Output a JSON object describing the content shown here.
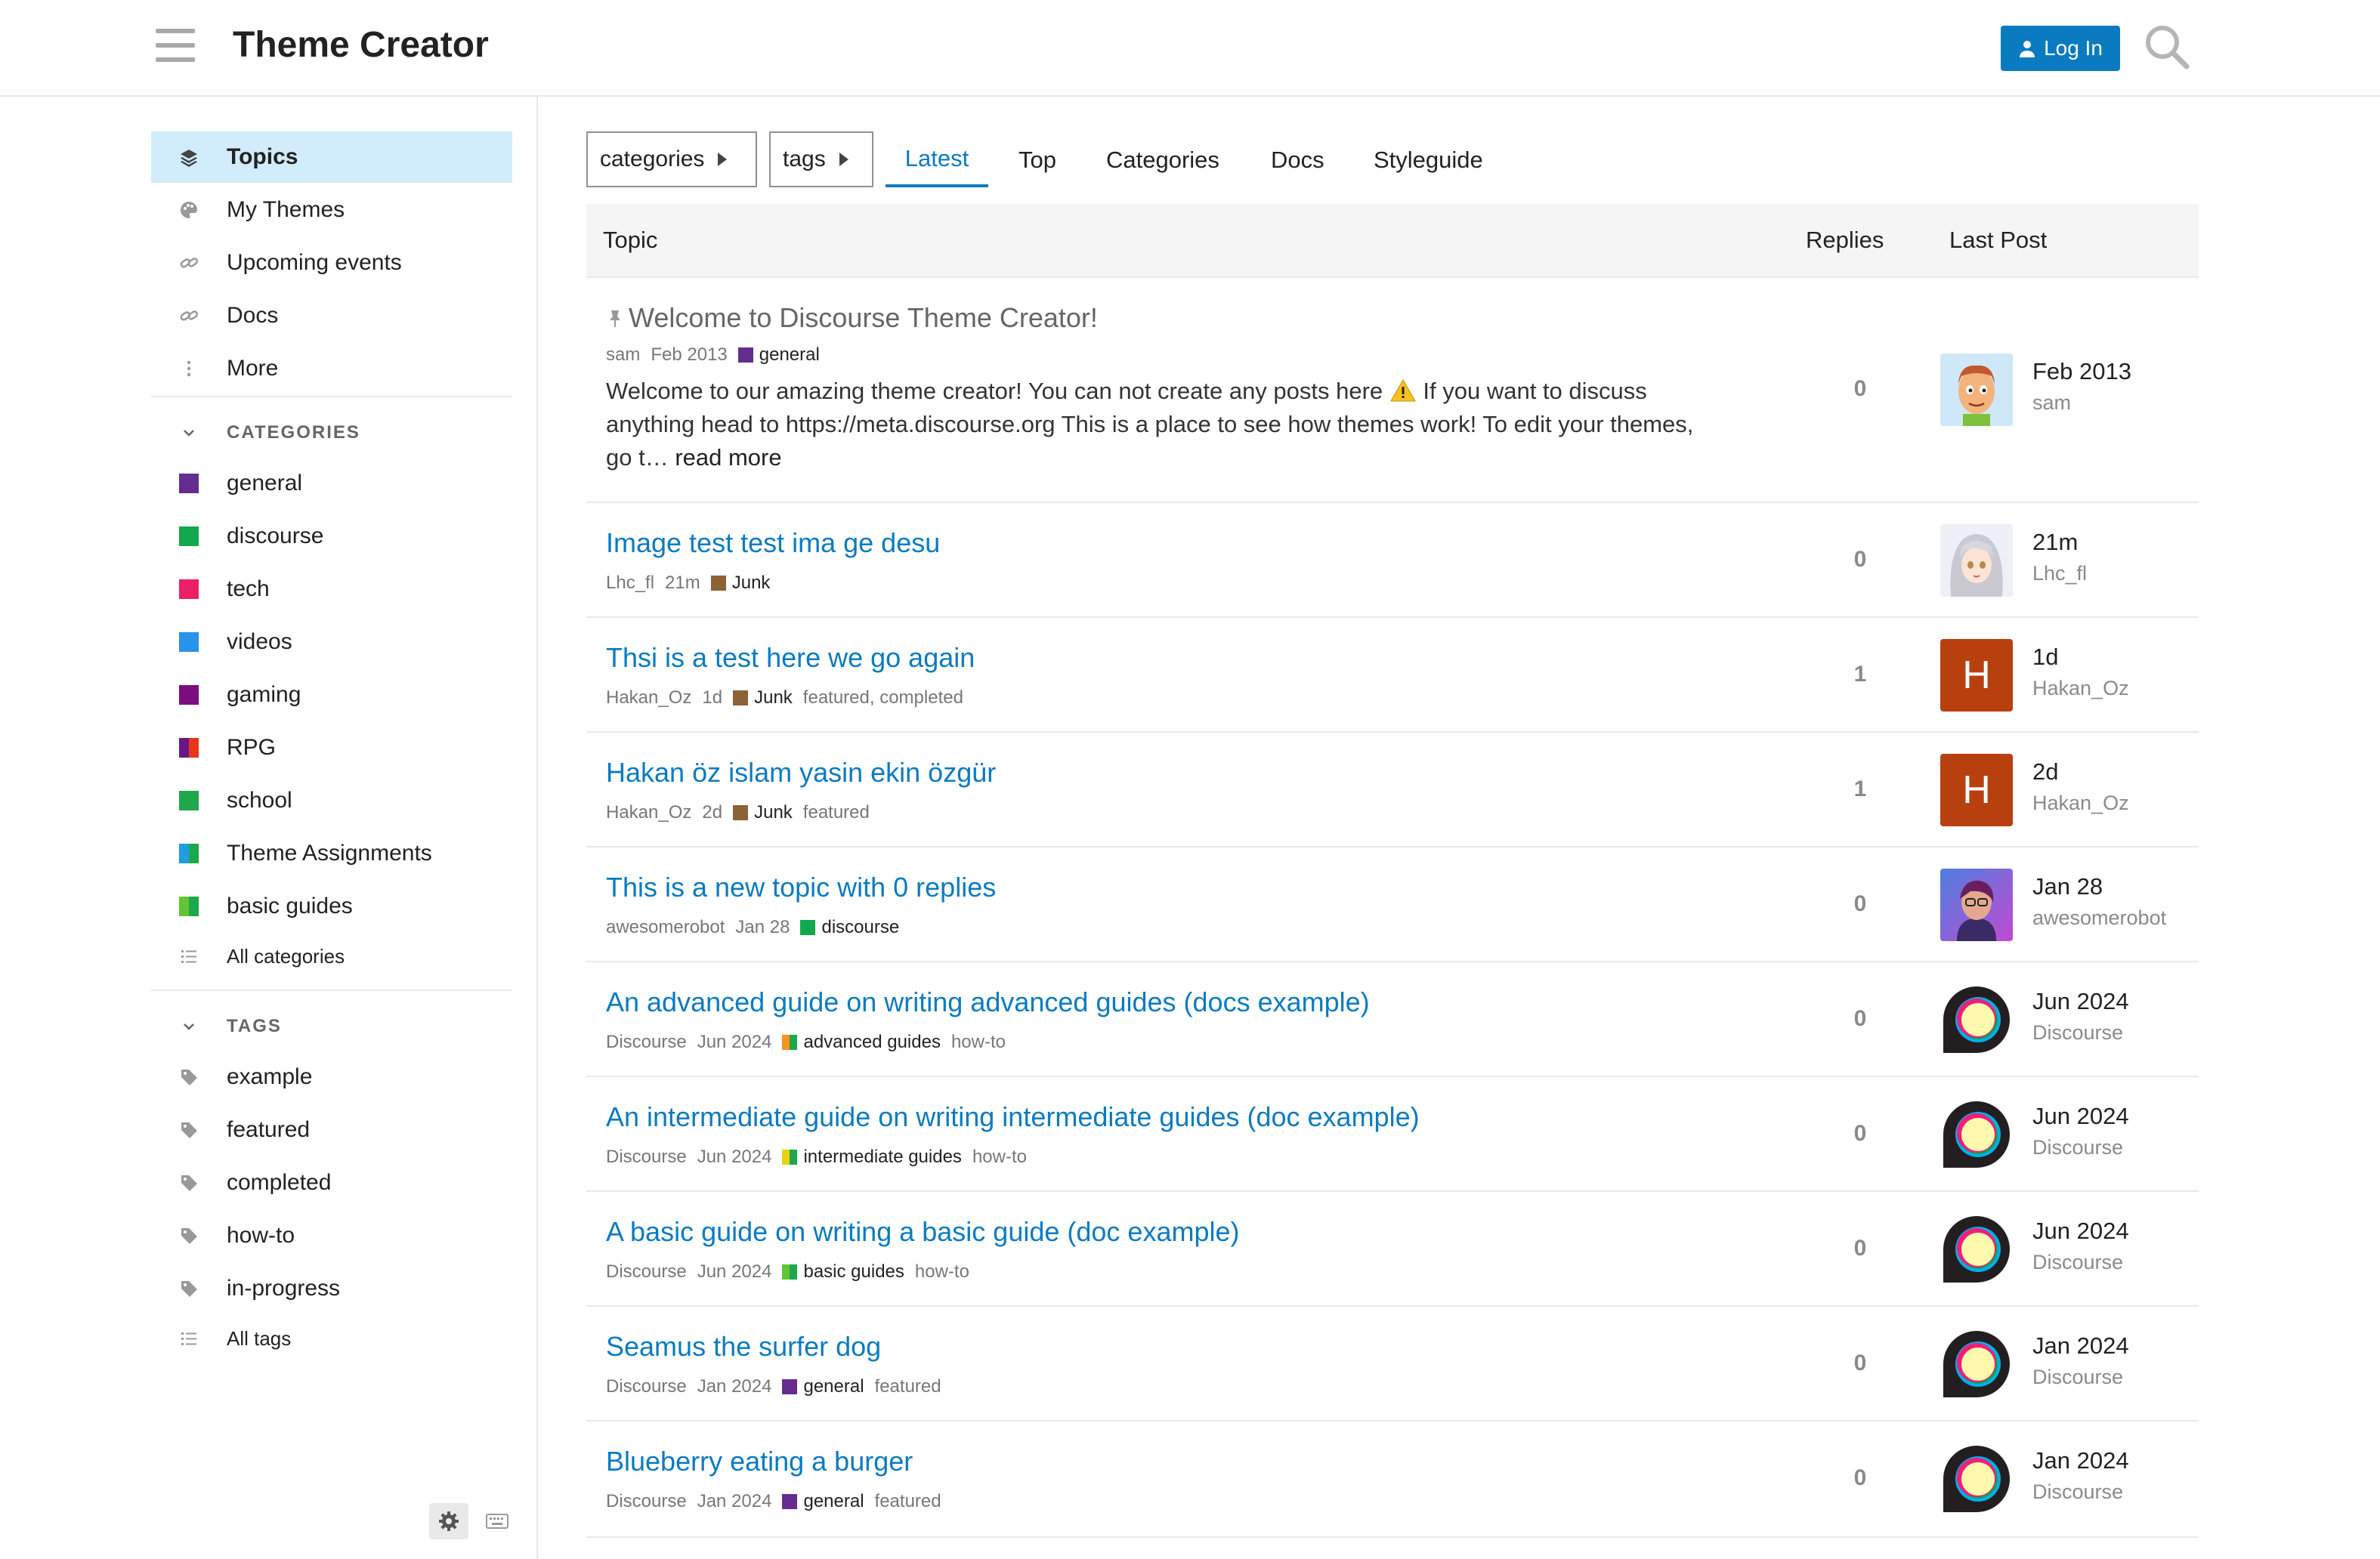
{
  "header": {
    "site_title": "Theme Creator",
    "login_label": "Log In"
  },
  "sidebar": {
    "primary": [
      {
        "label": "Topics",
        "icon": "layers-icon",
        "active": true
      },
      {
        "label": "My Themes",
        "icon": "palette-icon"
      },
      {
        "label": "Upcoming events",
        "icon": "link-icon"
      },
      {
        "label": "Docs",
        "icon": "link-icon"
      },
      {
        "label": "More",
        "icon": "ellipsis-vertical-icon"
      }
    ],
    "categories_header": "CATEGORIES",
    "categories": [
      {
        "label": "general",
        "color": "#652d90"
      },
      {
        "label": "discourse",
        "color": "#12a84d"
      },
      {
        "label": "tech",
        "color": "#ee1e66"
      },
      {
        "label": "videos",
        "color": "#2793ea"
      },
      {
        "label": "gaming",
        "color": "#7c0d7e"
      },
      {
        "label": "RPG",
        "color": "#e9361a",
        "color2": "#6b1685"
      },
      {
        "label": "school",
        "color": "#1ea84b"
      },
      {
        "label": "Theme Assignments",
        "color": "#1e9ee0",
        "color2": "#1ea84b"
      },
      {
        "label": "basic guides",
        "color": "#60c733",
        "color2": "#1ea84b"
      }
    ],
    "all_categories_label": "All categories",
    "tags_header": "TAGS",
    "tags": [
      "example",
      "featured",
      "completed",
      "how-to",
      "in-progress"
    ],
    "all_tags_label": "All tags"
  },
  "nav": {
    "categories_dropdown": "categories",
    "tags_dropdown": "tags",
    "tabs": [
      "Latest",
      "Top",
      "Categories",
      "Docs",
      "Styleguide"
    ]
  },
  "table": {
    "headers": {
      "topic": "Topic",
      "replies": "Replies",
      "last_post": "Last Post"
    },
    "rows": [
      {
        "title": "Welcome to Discourse Theme Creator!",
        "pinned": true,
        "poster": "sam",
        "date": "Feb 2013",
        "category": "general",
        "category_color": "#652d90",
        "tags": "",
        "excerpt_part1": "Welcome to our amazing theme creator! You can not create any posts here ",
        "excerpt_part2": " If you want to discuss anything head to https://meta.discourse.org This is a place to see how themes work! To edit your themes, go t… ",
        "read_more": "read more",
        "replies": "0",
        "last_date": "Feb 2013",
        "last_user": "sam",
        "avatar": "sam-avatar"
      },
      {
        "title": "Image test test ima ge desu",
        "poster": "Lhc_fl",
        "date": "21m",
        "category": "Junk",
        "category_color": "#8c6238",
        "tags": "",
        "replies": "0",
        "last_date": "21m",
        "last_user": "Lhc_fl",
        "avatar": "anime-avatar"
      },
      {
        "title": "Thsi is a test here we go again",
        "poster": "Hakan_Oz",
        "date": "1d",
        "category": "Junk",
        "category_color": "#8c6238",
        "tags": "featured, completed",
        "replies": "1",
        "last_date": "1d",
        "last_user": "Hakan_Oz",
        "avatar_letter": "H"
      },
      {
        "title": "Hakan öz islam yasin ekin özgür",
        "poster": "Hakan_Oz",
        "date": "2d",
        "category": "Junk",
        "category_color": "#8c6238",
        "tags": "featured",
        "replies": "1",
        "last_date": "2d",
        "last_user": "Hakan_Oz",
        "avatar_letter": "H"
      },
      {
        "title": "This is a new topic with 0 replies",
        "poster": "awesomerobot",
        "date": "Jan 28",
        "category": "discourse",
        "category_color": "#12a84d",
        "tags": "",
        "replies": "0",
        "last_date": "Jan 28",
        "last_user": "awesomerobot",
        "avatar": "robot-avatar"
      },
      {
        "title": "An advanced guide on writing advanced guides (docs example)",
        "poster": "Discourse",
        "date": "Jun 2024",
        "category": "advanced guides",
        "category_color": "#f7941d",
        "category_color2": "#1ea84b",
        "tags": "how-to",
        "replies": "0",
        "last_date": "Jun 2024",
        "last_user": "Discourse",
        "avatar": "discourse-logo"
      },
      {
        "title": "An intermediate guide on writing intermediate guides (doc example)",
        "poster": "Discourse",
        "date": "Jun 2024",
        "category": "intermediate guides",
        "category_color": "#e8d212",
        "category_color2": "#1ea84b",
        "tags": "how-to",
        "replies": "0",
        "last_date": "Jun 2024",
        "last_user": "Discourse",
        "avatar": "discourse-logo"
      },
      {
        "title": "A basic guide on writing a basic guide (doc example)",
        "poster": "Discourse",
        "date": "Jun 2024",
        "category": "basic guides",
        "category_color": "#60c733",
        "category_color2": "#1ea84b",
        "tags": "how-to",
        "replies": "0",
        "last_date": "Jun 2024",
        "last_user": "Discourse",
        "avatar": "discourse-logo"
      },
      {
        "title": "Seamus the surfer dog",
        "poster": "Discourse",
        "date": "Jan 2024",
        "category": "general",
        "category_color": "#652d90",
        "tags": "featured",
        "replies": "0",
        "last_date": "Jan 2024",
        "last_user": "Discourse",
        "avatar": "discourse-logo"
      },
      {
        "title": "Blueberry eating a burger",
        "poster": "Discourse",
        "date": "Jan 2024",
        "category": "general",
        "category_color": "#652d90",
        "tags": "featured",
        "replies": "0",
        "last_date": "Jan 2024",
        "last_user": "Discourse",
        "avatar": "discourse-logo"
      }
    ]
  },
  "colors": {
    "accent": "#0a7bc1",
    "active_bg": "#d1ecfb",
    "letter_avatar": "#b8400f"
  }
}
